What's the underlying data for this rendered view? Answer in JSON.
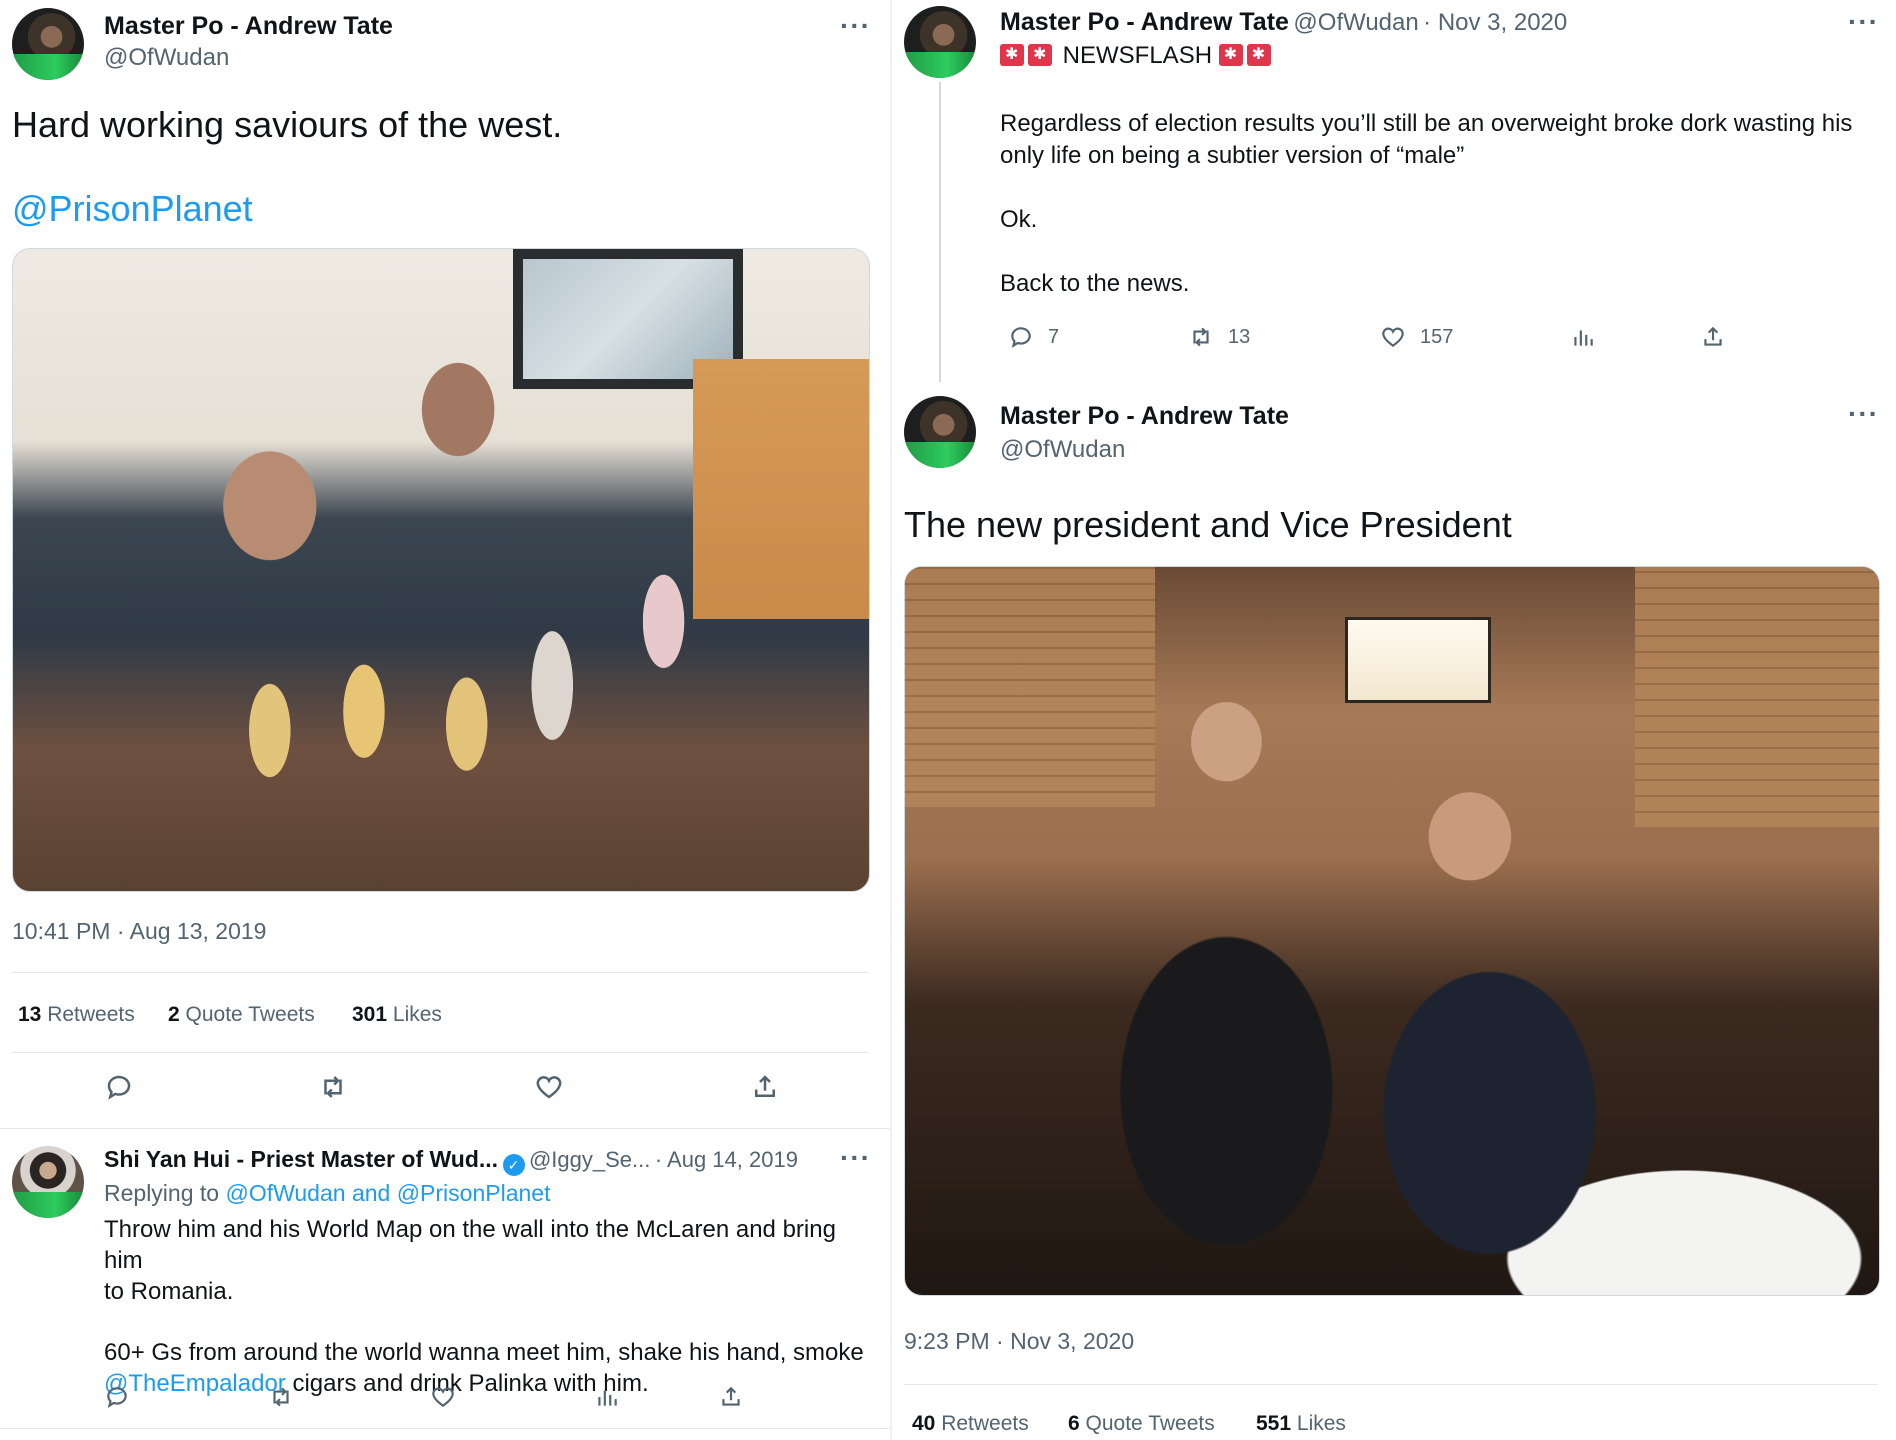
{
  "left_tweet": {
    "author_name": "Master Po - Andrew Tate",
    "author_handle": "@OfWudan",
    "more": "···",
    "text": "Hard working saviours of the west.",
    "mention": "@PrisonPlanet",
    "timestamp": "10:41 PM · Aug 13, 2019",
    "stats": {
      "retweets_count": "13",
      "retweets_label": "Retweets",
      "quotes_count": "2",
      "quotes_label": "Quote Tweets",
      "likes_count": "301",
      "likes_label": "Likes"
    },
    "actions": [
      "reply-icon",
      "retweet-icon",
      "like-icon",
      "share-icon"
    ]
  },
  "reply_tweet": {
    "author_name": "Shi Yan Hui - Priest Master of Wud...",
    "author_handle": "@Iggy_Se...",
    "date": "· Aug 14, 2019",
    "more": "···",
    "replying_prefix": "Replying to",
    "replying_to": "@OfWudan and @PrisonPlanet",
    "text_line1": "Throw him and his World Map on the wall into the McLaren and bring him",
    "text_line2": "to Romania.",
    "text_line3": "60+ Gs from around the world wanna meet him, shake his hand, smoke",
    "mention": "@TheEmpalador",
    "text_line4_rest": " cigars and drink Palinka with him.",
    "actions": [
      "reply-icon",
      "retweet-icon",
      "like-icon",
      "analytics-icon",
      "share-icon"
    ]
  },
  "right_top_tweet": {
    "author_name": "Master Po - Andrew Tate",
    "author_handle": "@OfWudan",
    "date": "· Nov 3, 2020",
    "more": "···",
    "headline": "NEWSFLASH",
    "text_line1": "Regardless of election results you’ll still be an overweight broke dork wasting his",
    "text_line2": "only life on being a subtier version of “male”",
    "text_line3": "Ok.",
    "text_line4": "Back to the news.",
    "reply_count": "7",
    "retweet_count": "13",
    "like_count": "157"
  },
  "right_main_tweet": {
    "author_name": "Master Po - Andrew Tate",
    "author_handle": "@OfWudan",
    "more": "···",
    "text": "The new president and Vice President",
    "timestamp": "9:23 PM · Nov 3, 2020",
    "stats": {
      "retweets_count": "40",
      "retweets_label": "Retweets",
      "quotes_count": "6",
      "quotes_label": "Quote Tweets",
      "likes_count": "551",
      "likes_label": "Likes"
    }
  },
  "colors": {
    "link": "#1d9bf0",
    "secondary_text": "#536471",
    "primary_text": "#0f1419"
  }
}
